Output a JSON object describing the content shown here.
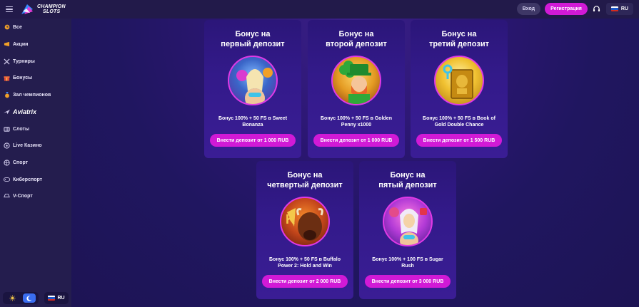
{
  "header": {
    "logo_line1": "CHAMPION",
    "logo_line2": "SLOTS",
    "login_label": "Вход",
    "register_label": "Регистрация",
    "language": "RU"
  },
  "sidebar": {
    "items": [
      {
        "label": "Все",
        "icon": "clock-icon"
      },
      {
        "label": "Акции",
        "icon": "promo-icon"
      },
      {
        "label": "Турниры",
        "icon": "swords-icon"
      },
      {
        "label": "Бонусы",
        "icon": "gift-icon"
      },
      {
        "label": "Зал чемпионов",
        "icon": "medal-icon"
      },
      {
        "label": "Aviatrix",
        "icon": "plane-icon"
      },
      {
        "label": "Слоты",
        "icon": "slots-icon"
      },
      {
        "label": "Live Казино",
        "icon": "live-casino-icon"
      },
      {
        "label": "Спорт",
        "icon": "ball-icon"
      },
      {
        "label": "Киберспорт",
        "icon": "gamepad-icon"
      },
      {
        "label": "V-Спорт",
        "icon": "controller-icon"
      }
    ],
    "language": "RU"
  },
  "bonuses": [
    {
      "title_line1": "Бонус на",
      "title_line2": "первый депозит",
      "desc": "Бонус 100% + 50 FS в Sweet Bonanza",
      "button": "Внести депозит от 1 000 RUB"
    },
    {
      "title_line1": "Бонус на",
      "title_line2": "второй депозит",
      "desc": "Бонус 100% + 50 FS в Golden Penny x1000",
      "button": "Внести депозит от 1 000 RUB"
    },
    {
      "title_line1": "Бонус на",
      "title_line2": "третий депозит",
      "desc": "Бонус 100% + 50 FS в Book of Gold Double Chance",
      "button": "Внести депозит от 1 500 RUB"
    },
    {
      "title_line1": "Бонус на",
      "title_line2": "четвертый депозит",
      "desc": "Бонус 100% + 50 FS в Buffalo Power 2: Hold and Win",
      "button": "Внести депозит от 2 000 RUB"
    },
    {
      "title_line1": "Бонус на",
      "title_line2": "пятый депозит",
      "desc": "Бонус 100% + 100 FS в Sugar Rush",
      "button": "Внести депозит от 3 000 RUB"
    }
  ],
  "colors": {
    "accent": "#d11ad6",
    "header_bg": "#221a4a",
    "sidebar_bg": "#241d4e"
  }
}
